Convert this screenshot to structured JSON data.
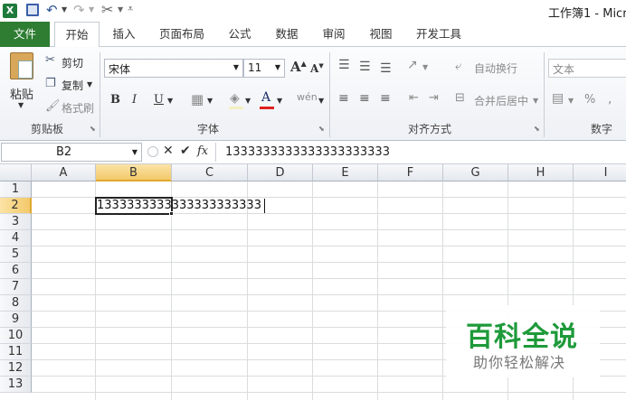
{
  "window": {
    "title": "工作簿1 - Micr"
  },
  "tabs": [
    {
      "label": "文件"
    },
    {
      "label": "开始"
    },
    {
      "label": "插入"
    },
    {
      "label": "页面布局"
    },
    {
      "label": "公式"
    },
    {
      "label": "数据"
    },
    {
      "label": "审阅"
    },
    {
      "label": "视图"
    },
    {
      "label": "开发工具"
    }
  ],
  "ribbon": {
    "clipboard": {
      "paste": "粘贴",
      "cut": "剪切",
      "copy": "复制",
      "format_painter": "格式刷",
      "group_label": "剪贴板"
    },
    "font": {
      "family": "宋体",
      "size": "11",
      "group_label": "字体",
      "bold": "B",
      "italic": "I",
      "underline": "U"
    },
    "alignment": {
      "wrap": "自动换行",
      "merge": "合并后居中",
      "group_label": "对齐方式"
    },
    "number": {
      "format": "文本",
      "group_label": "数字"
    }
  },
  "formula_bar": {
    "name_box": "B2",
    "fx": "fx",
    "content": "1333333333333333333333"
  },
  "sheet": {
    "columns": [
      "A",
      "B",
      "C",
      "D",
      "E",
      "F",
      "G",
      "H",
      "I"
    ],
    "rows": [
      "1",
      "2",
      "3",
      "4",
      "5",
      "6",
      "7",
      "8",
      "9",
      "10",
      "11",
      "12",
      "13"
    ],
    "cell_b2": "1333333333333333333333",
    "active_cell": "B2"
  },
  "watermark": {
    "title": "百科全说",
    "subtitle": "助你轻松解决"
  },
  "colors": {
    "file_tab": "#2e7d32",
    "accent_green": "#1e7a3b",
    "header_highlight": "#f7d37a",
    "font_color_bar": "#e02020"
  }
}
